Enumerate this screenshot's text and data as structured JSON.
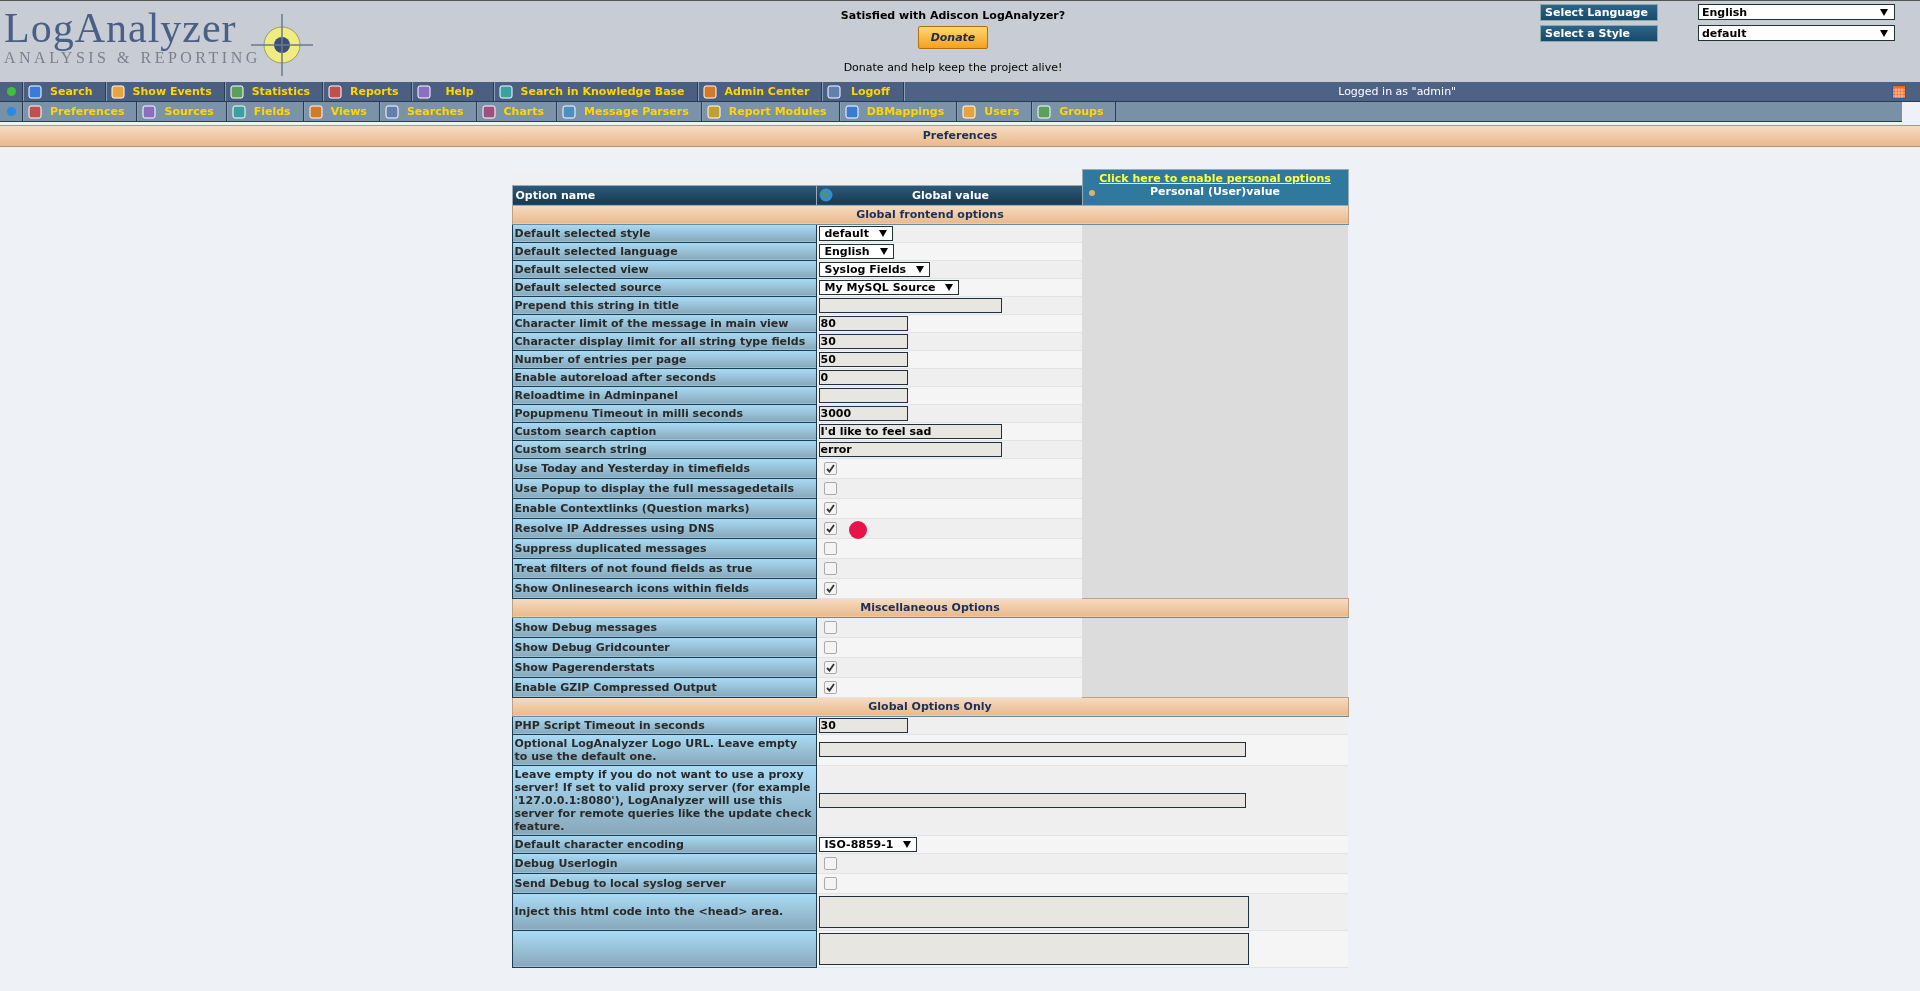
{
  "header": {
    "logo": {
      "title": "LogAnalyzer",
      "subtitle": "ANALYSIS & REPORTING"
    },
    "donate": {
      "question": "Satisfied with Adiscon LogAnalyzer?",
      "button": "Donate",
      "note": "Donate and help keep the project alive!"
    },
    "selectors": [
      {
        "label": "Select Language",
        "value": "English"
      },
      {
        "label": "Select a Style",
        "value": "default"
      }
    ]
  },
  "menu_bars": [
    {
      "items": [
        {
          "label": "Search"
        },
        {
          "label": "Show Events"
        },
        {
          "label": "Statistics"
        },
        {
          "label": "Reports"
        },
        {
          "label": "Help"
        },
        {
          "label": "Search in Knowledge Base"
        },
        {
          "label": "Admin Center"
        },
        {
          "label": "Logoff"
        }
      ],
      "status": "Logged in as \"admin\""
    },
    {
      "items": [
        {
          "label": "Preferences"
        },
        {
          "label": "Sources"
        },
        {
          "label": "Fields"
        },
        {
          "label": "Views"
        },
        {
          "label": "Searches"
        },
        {
          "label": "Charts"
        },
        {
          "label": "Message Parsers"
        },
        {
          "label": "Report Modules"
        },
        {
          "label": "DBMappings"
        },
        {
          "label": "Users"
        },
        {
          "label": "Groups"
        }
      ]
    }
  ],
  "page_title": "Preferences",
  "table": {
    "columns": {
      "option": "Option name",
      "global": "Global value",
      "personal_link": "Click here to enable personal options",
      "personal": "Personal (User)value"
    },
    "sections": [
      {
        "title": "Global frontend options",
        "personal_column": true,
        "rows": [
          {
            "label": "Default selected style",
            "kind": "select",
            "value": "default"
          },
          {
            "label": "Default selected language",
            "kind": "select",
            "value": "English"
          },
          {
            "label": "Default selected view",
            "kind": "select",
            "value": "Syslog Fields"
          },
          {
            "label": "Default selected source",
            "kind": "select",
            "value": "My MySQL Source"
          },
          {
            "label": "Prepend this string in title",
            "kind": "text"
          },
          {
            "label": "Character limit of the message in main view",
            "kind": "number",
            "value": "80"
          },
          {
            "label": "Character display limit for all string type fields",
            "kind": "number",
            "value": "30"
          },
          {
            "label": "Number of entries per page",
            "kind": "number",
            "value": "50"
          },
          {
            "label": "Enable autoreload after seconds",
            "kind": "number",
            "value": "0"
          },
          {
            "label": "Reloadtime in Adminpanel",
            "kind": "number"
          },
          {
            "label": "Popupmenu Timeout in milli seconds",
            "kind": "number",
            "value": "3000"
          },
          {
            "label": "Custom search caption",
            "kind": "text",
            "value": "I'd like to feel sad"
          },
          {
            "label": "Custom search string",
            "kind": "text",
            "value": "error"
          },
          {
            "label": "Use Today and Yesterday in timefields",
            "kind": "checkbox",
            "checked": true
          },
          {
            "label": "Use Popup to display the full messagedetails",
            "kind": "checkbox",
            "checked": false
          },
          {
            "label": "Enable Contextlinks (Question marks)",
            "kind": "checkbox",
            "checked": true
          },
          {
            "label": "Resolve IP Addresses using DNS",
            "kind": "checkbox",
            "checked": true
          },
          {
            "label": "Suppress duplicated messages",
            "kind": "checkbox",
            "checked": false
          },
          {
            "label": "Treat filters of not found fields as true",
            "kind": "checkbox",
            "checked": false
          },
          {
            "label": "Show Onlinesearch icons within fields",
            "kind": "checkbox",
            "checked": true
          }
        ]
      },
      {
        "title": "Miscellaneous Options",
        "personal_column": true,
        "rows": [
          {
            "label": "Show Debug messages",
            "kind": "checkbox",
            "checked": false
          },
          {
            "label": "Show Debug Gridcounter",
            "kind": "checkbox",
            "checked": false
          },
          {
            "label": "Show Pagerenderstats",
            "kind": "checkbox",
            "checked": true
          },
          {
            "label": "Enable GZIP Compressed Output",
            "kind": "checkbox",
            "checked": true
          }
        ]
      },
      {
        "title": "Global Options Only",
        "personal_column": false,
        "rows": [
          {
            "label": "PHP Script Timeout in seconds",
            "kind": "number",
            "value": "30"
          },
          {
            "label": "Optional LogAnalyzer Logo URL. Leave empty to use the default one.",
            "kind": "wide_text"
          },
          {
            "label": "Leave empty if you do not want to use a proxy server! If set to valid proxy server (for example '127.0.0.1:8080'), LogAnalyzer will use this server for remote queries like the update check feature.",
            "kind": "wide_text"
          },
          {
            "label": "Default character encoding",
            "kind": "select",
            "value": "ISO-8859-1"
          },
          {
            "label": "Debug Userlogin",
            "kind": "checkbox",
            "checked": false
          },
          {
            "label": "Send Debug to local syslog server",
            "kind": "checkbox",
            "checked": false
          },
          {
            "label": "Inject this html code into the <head> area.",
            "kind": "textarea"
          },
          {
            "kind": "textarea"
          }
        ]
      }
    ]
  }
}
